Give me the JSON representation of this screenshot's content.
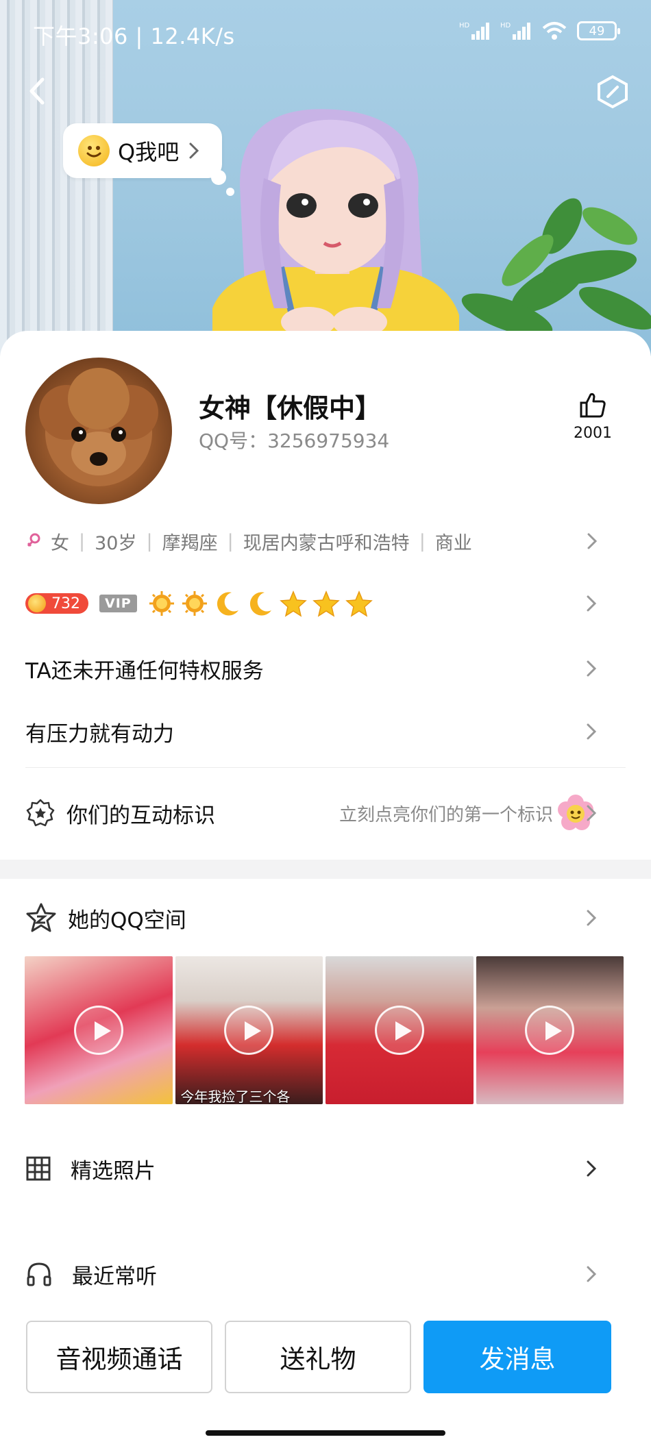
{
  "status_bar": {
    "time": "下午3:06 | 12.4K/s",
    "signal1": "HD",
    "signal2": "HD",
    "battery": "49"
  },
  "header": {
    "bubble_text": "Q我吧",
    "icons": [
      "back-arrow-icon",
      "edit-icon",
      "smile-icon",
      "chevron-right-icon"
    ]
  },
  "profile": {
    "nickname": "女神【休假中】",
    "qq_number": "QQ号：3256975934",
    "likes": "2001"
  },
  "info": {
    "gender": "女",
    "age": "30岁",
    "zodiac": "摩羯座",
    "location": "现居内蒙古呼和浩特",
    "industry": "商业"
  },
  "level": {
    "badge": "732",
    "vip": "VIP",
    "icons": [
      "sun-icon",
      "sun-icon",
      "moon-icon",
      "moon-icon",
      "star-icon",
      "star-icon",
      "star-icon"
    ]
  },
  "privilege": "TA还未开通任何特权服务",
  "signature": "有压力就有动力",
  "interaction": {
    "label": "你们的互动标识",
    "hint": "立刻点亮你们的第一个标识"
  },
  "qzone": {
    "label": "她的QQ空间",
    "thumb_caption": "今年我捡了三个各"
  },
  "sections": {
    "photos": "精选照片",
    "music": "最近常听"
  },
  "actions": {
    "call": "音视频通话",
    "gift": "送礼物",
    "message": "发消息"
  },
  "colors": {
    "primary": "#0f9bf6",
    "level_badge": "#f04a3a"
  }
}
